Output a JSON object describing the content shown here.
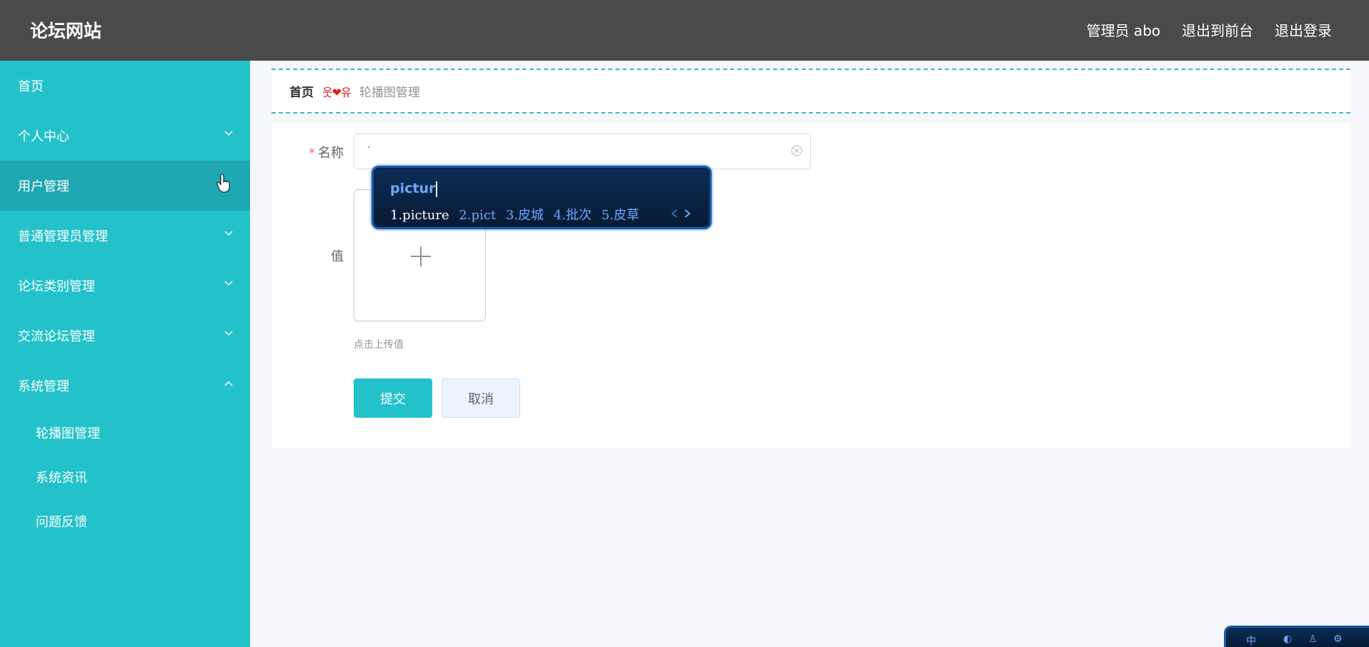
{
  "header": {
    "brand": "论坛网站",
    "admin_label": "管理员 abo",
    "exit_front": "退出到前台",
    "logout": "退出登录"
  },
  "sidebar": {
    "items": [
      {
        "label": "首页",
        "chevron": ""
      },
      {
        "label": "个人中心",
        "chevron": "down"
      },
      {
        "label": "用户管理",
        "chevron": ""
      },
      {
        "label": "普通管理员管理",
        "chevron": "down"
      },
      {
        "label": "论坛类别管理",
        "chevron": "down"
      },
      {
        "label": "交流论坛管理",
        "chevron": "down"
      },
      {
        "label": "系统管理",
        "chevron": "up"
      }
    ],
    "sub_items": [
      {
        "label": "轮播图管理"
      },
      {
        "label": "系统资讯"
      },
      {
        "label": "问题反馈"
      }
    ]
  },
  "breadcrumb": {
    "home": "首页",
    "separator": "웃❤유",
    "current": "轮播图管理"
  },
  "form": {
    "name_label": "名称",
    "required_mark": "*",
    "name_value": ".",
    "value_label": "值",
    "upload_hint": "点击上传值",
    "submit": "提交",
    "cancel": "取消"
  },
  "ime": {
    "composition": "pictur",
    "candidates": [
      "1.picture",
      "2.pict",
      "3.皮城",
      "4.批次",
      "5.皮草"
    ]
  },
  "ime_toolbar": {
    "mode": "中"
  },
  "colors": {
    "sidebar": "#23c2cb",
    "topbar": "#4a4a4a",
    "accent": "#23c2cb"
  }
}
